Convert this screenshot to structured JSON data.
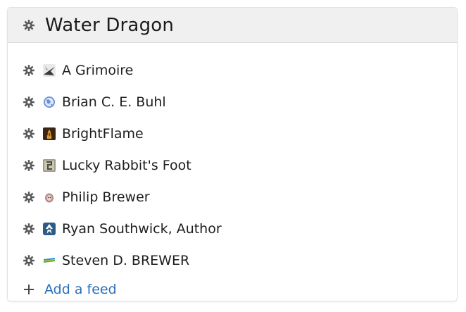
{
  "panel": {
    "title": "Water Dragon",
    "header_icon": "gear-icon"
  },
  "feeds": [
    {
      "label": "A Grimoire",
      "icon": "grimoire-favicon",
      "color": "#3a3a3a"
    },
    {
      "label": "Brian C. E. Buhl",
      "icon": "globe-favicon",
      "color": "#6a8fd6"
    },
    {
      "label": "BrightFlame",
      "icon": "brightflame-favicon",
      "color": "#3b2410"
    },
    {
      "label": "Lucky Rabbit's Foot",
      "icon": "rabbit-favicon",
      "color": "#8f8f7a"
    },
    {
      "label": "Philip Brewer",
      "icon": "philip-favicon",
      "color": "#b78a8a"
    },
    {
      "label": "Ryan Southwick, Author",
      "icon": "ryan-favicon",
      "color": "#2c5b86"
    },
    {
      "label": "Steven D. BREWER",
      "icon": "steven-favicon",
      "color": "#2e8fd8"
    }
  ],
  "add_feed": {
    "label": "Add a feed",
    "icon": "plus-icon",
    "color": "#2a6fb8"
  }
}
